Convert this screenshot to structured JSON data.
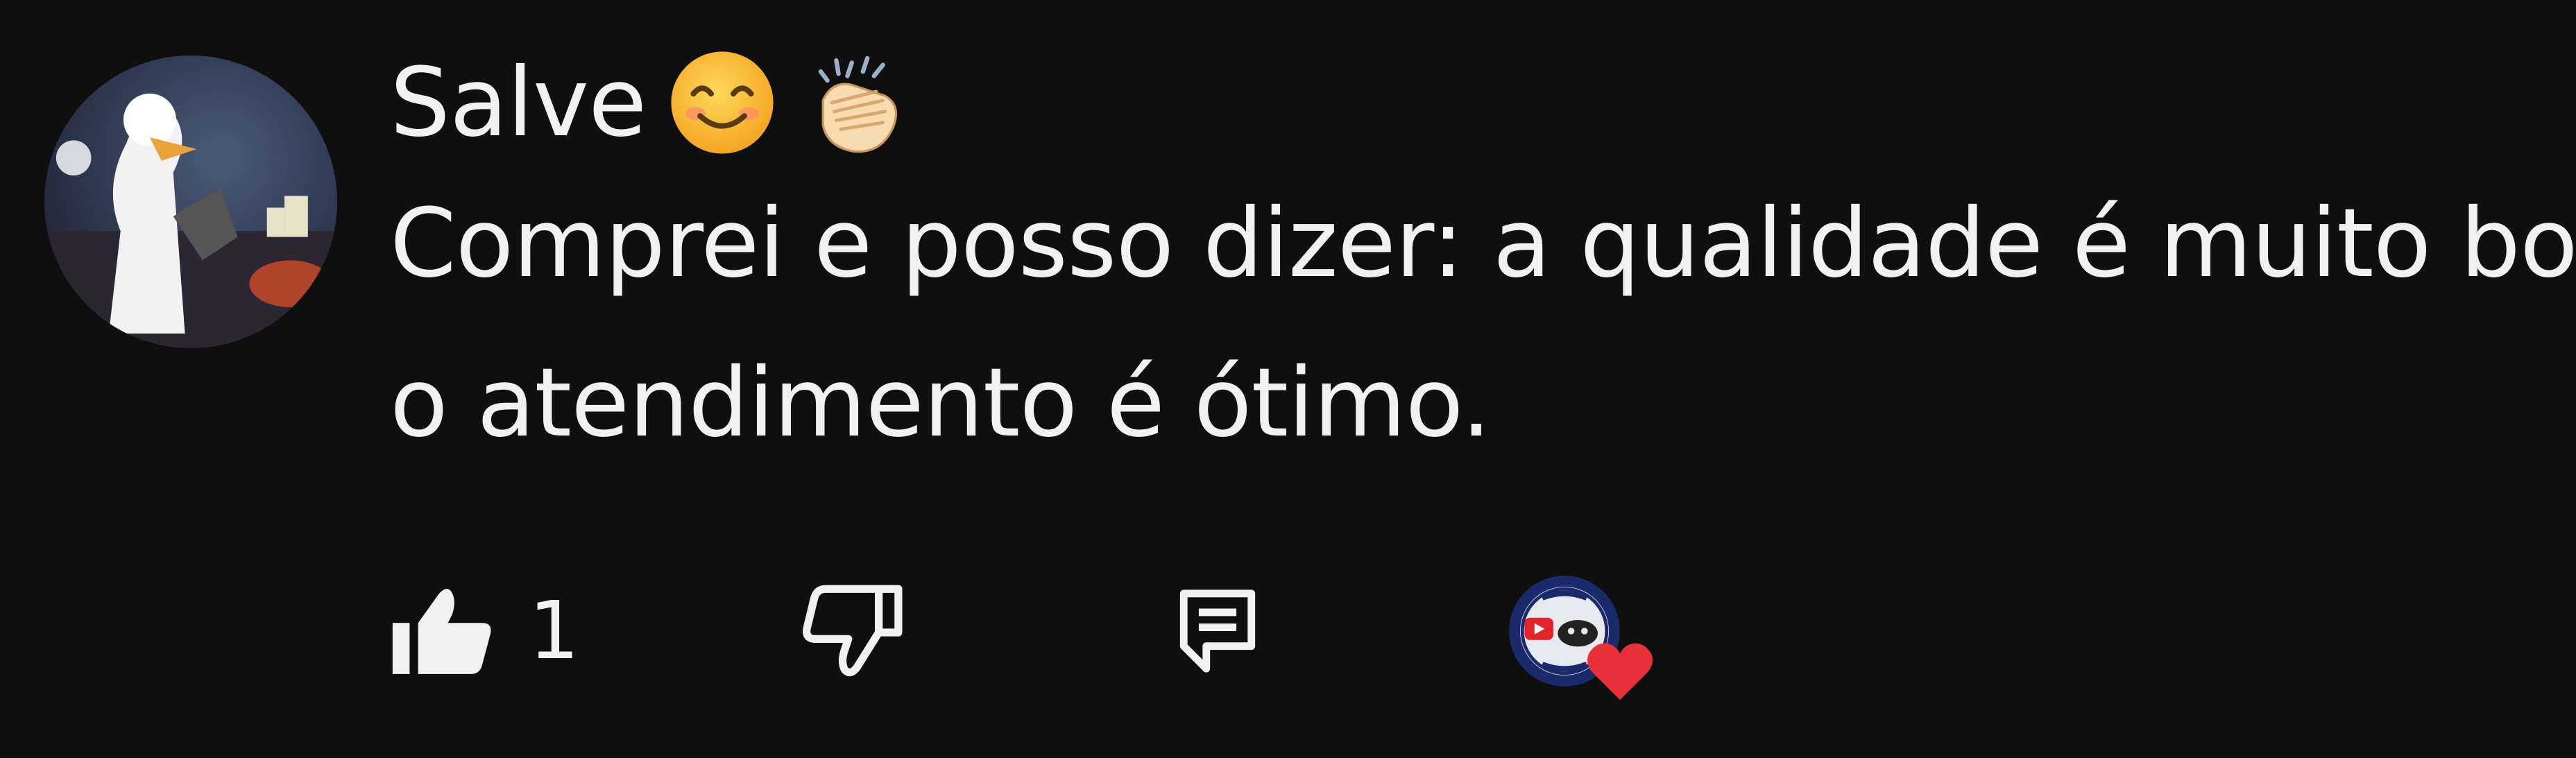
{
  "comment": {
    "line1": "Salve",
    "line2": "Comprei e posso dizer: a qualidade é muito boa",
    "line3": "o atendimento é ótimo.",
    "emojis": [
      "smiling-face-icon",
      "clapping-hands-icon"
    ]
  },
  "actions": {
    "like_count": "1",
    "like_icon": "thumbs-up-icon",
    "dislike_icon": "thumbs-down-icon",
    "reply_icon": "reply-icon",
    "hearted_icon": "creator-heart-icon"
  },
  "colors": {
    "background": "#0f0f0f",
    "text": "#f1f1f1",
    "heart": "#e8303a"
  }
}
